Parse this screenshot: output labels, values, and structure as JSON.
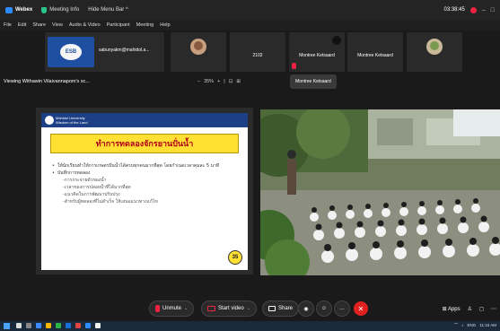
{
  "titlebar": {
    "app_name": "Webex",
    "meeting_info": "Meeting Info",
    "hide_menu": "Hide Menu Bar ^",
    "timer": "03:38:45",
    "minimize": "–",
    "maximize": "□"
  },
  "menu": [
    "File",
    "Edit",
    "Share",
    "View",
    "Audio & Video",
    "Participant",
    "Meeting",
    "Help"
  ],
  "participants": {
    "tile1_name": "sabunyakm@mahidol.a...",
    "tile3_name": "2102",
    "tile4_name": "Montree Ketsaard",
    "tile5_name": "Montree Ketsaard"
  },
  "viewbar": {
    "viewing": "Viewing Withawin Vilaivannapom's sc...",
    "zoom_out": "–",
    "zoom": "35%",
    "zoom_in": "+",
    "tooltip": "Montree Ketsaard"
  },
  "slide": {
    "uni_name": "Mahidol University",
    "uni_sub": "Wisdom of the Land",
    "title": "ทำการทดลองจักรยานปั่นน้ำ",
    "bullet1": "ให้นักเรียนทำให้การเกษตรปั่นน้ำได้ครบทุกคนมากที่สุด โดยกำเนดเวลาคุมละ 5 นาที",
    "bullet2": "บันทึกการทดลอง",
    "sub1": "-การกระจายตัวของน้ำ",
    "sub2": "-เวลาของการปล่อยน้ำที่ได้มากที่สุด",
    "sub3": "-แนวคิดในการพัฒนาปรับปรุง",
    "sub4": "-สำหรับผู้ทดลองที่ไม่สำเร็จ ให้เสนอแนวทางแก้ไข",
    "page": "35"
  },
  "toolbar": {
    "unmute": "Unmute",
    "start_video": "Start video",
    "share": "Share",
    "apps": "Apps"
  },
  "taskbar": {
    "lang": "ENG",
    "time": "11:16 AM"
  },
  "colors": {
    "accent": "#2d8cff",
    "danger": "#e02020",
    "slide_banner": "#ffe033"
  }
}
